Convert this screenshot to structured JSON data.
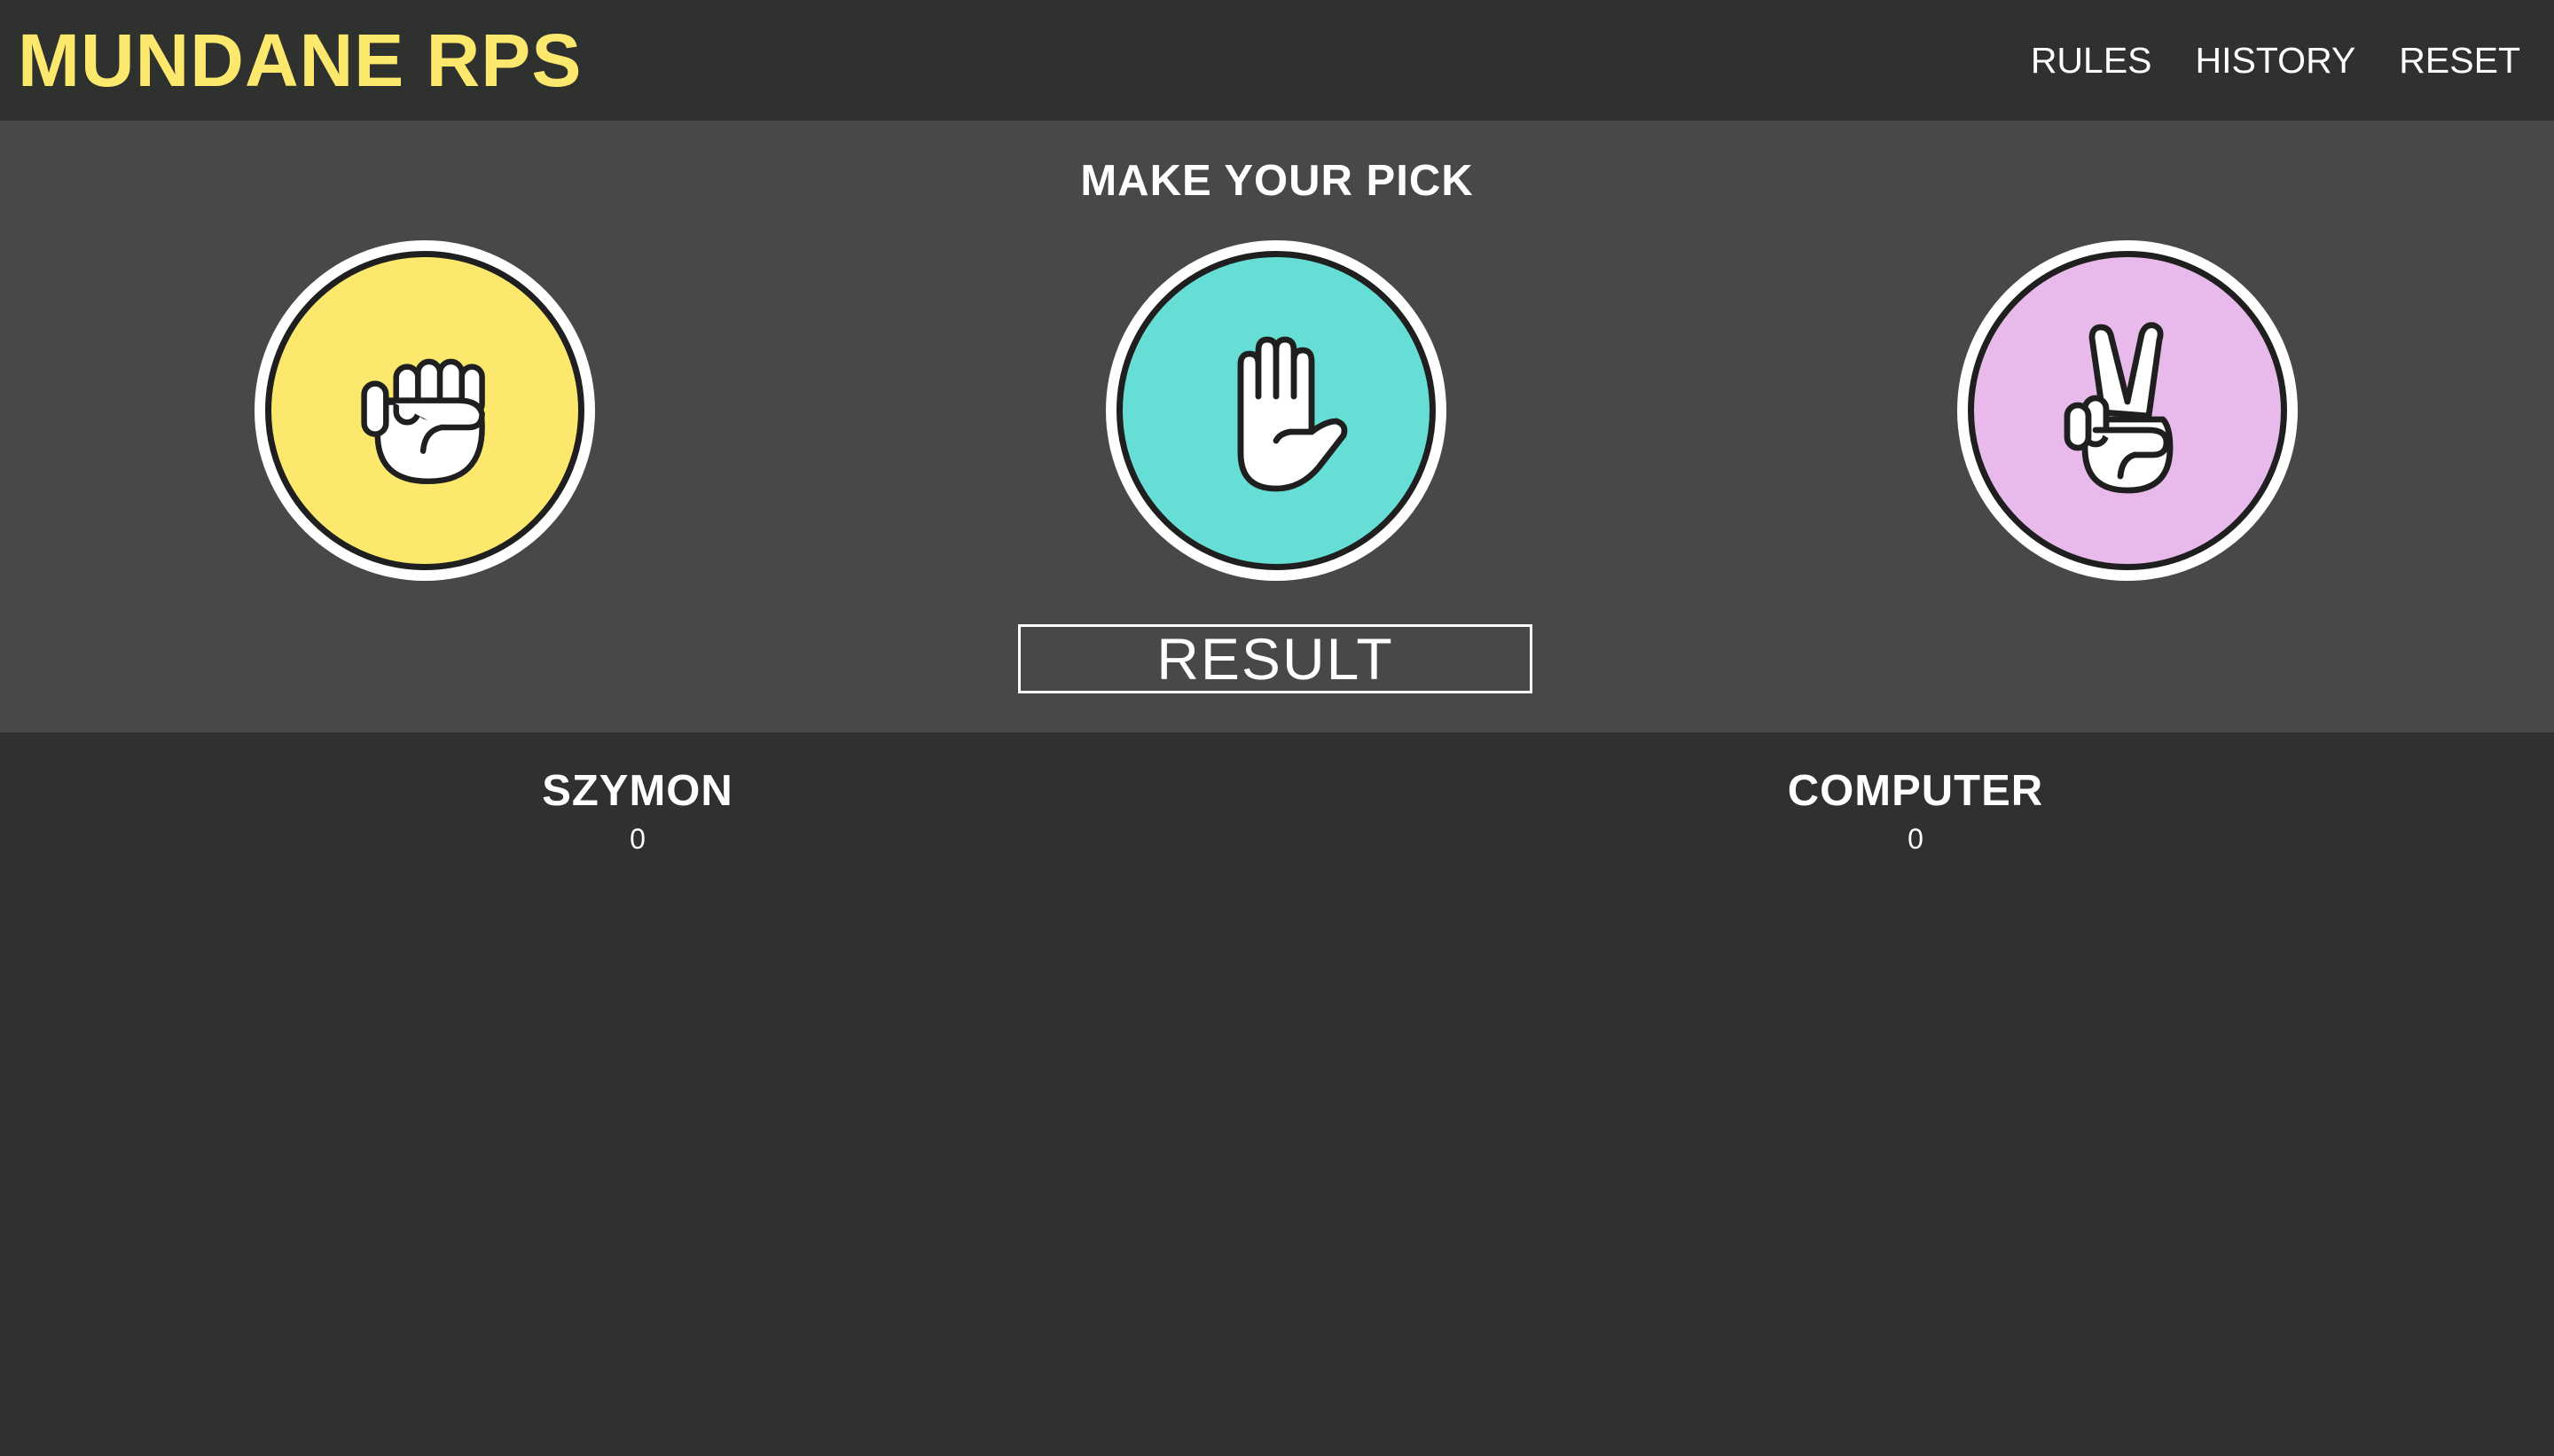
{
  "header": {
    "logo": "MUNDANE RPS",
    "nav": {
      "rules": "RULES",
      "history": "HISTORY",
      "reset": "RESET"
    }
  },
  "game": {
    "title": "MAKE YOUR PICK",
    "choices": [
      {
        "id": "rock",
        "icon": "fist-icon",
        "color": "#fce86d"
      },
      {
        "id": "paper",
        "icon": "open-hand-icon",
        "color": "#67ded5"
      },
      {
        "id": "scissors",
        "icon": "peace-sign-icon",
        "color": "#e7baeb"
      }
    ],
    "result": "RESULT"
  },
  "scoreboard": {
    "player": {
      "name": "SZYMON",
      "score": "0"
    },
    "computer": {
      "name": "COMPUTER",
      "score": "0"
    }
  },
  "colors": {
    "accent": "#fce86d",
    "background": "#2f312e",
    "panel": "#474946"
  }
}
